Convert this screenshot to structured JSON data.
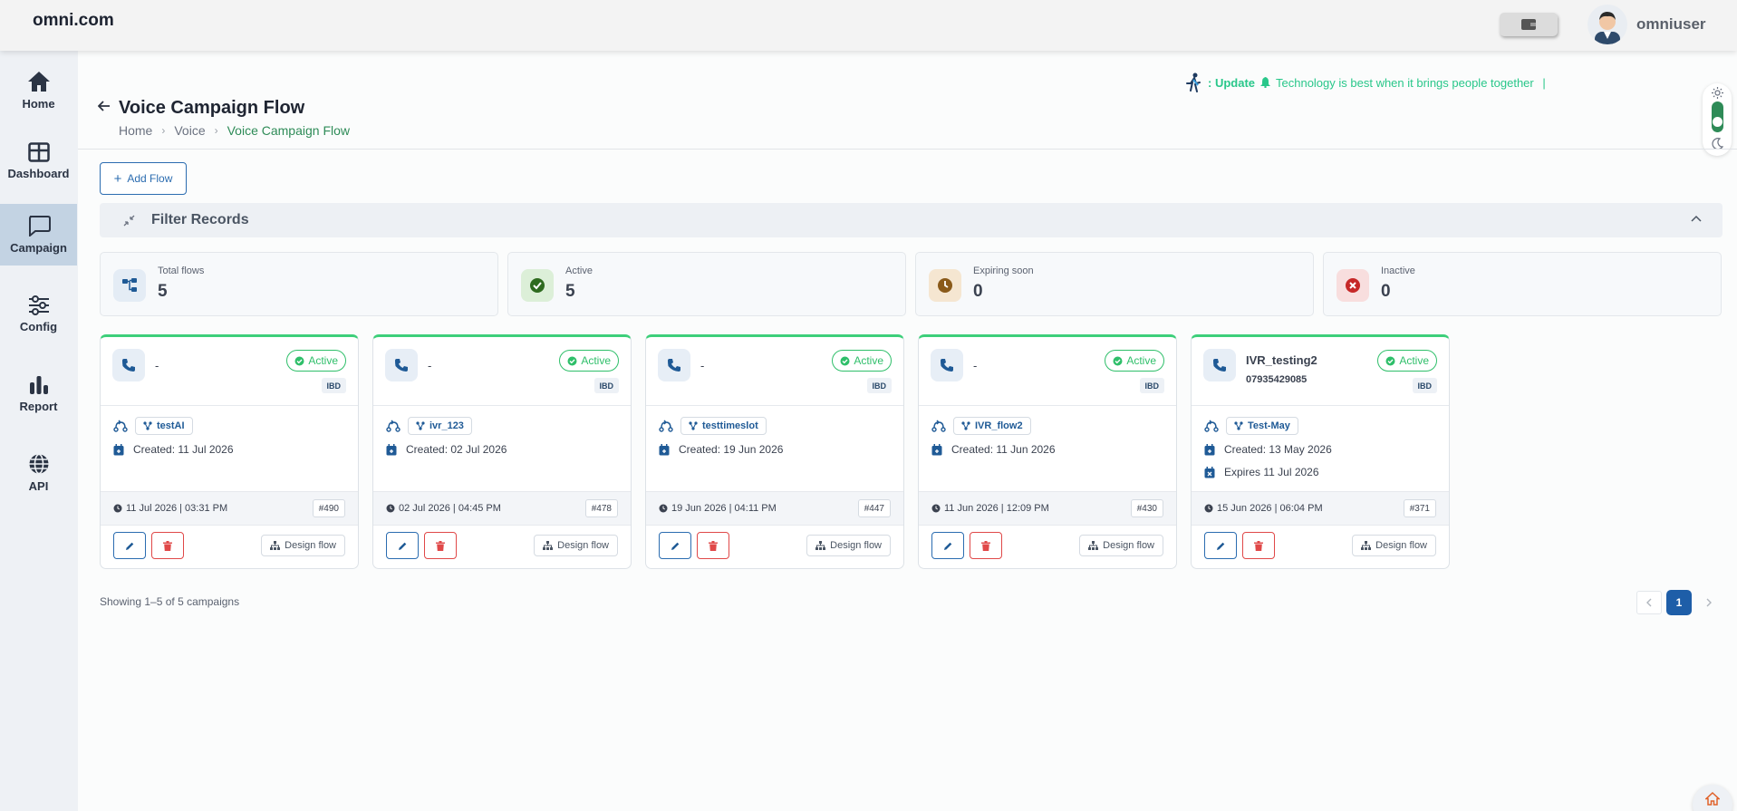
{
  "header": {
    "brand": "omni.com",
    "username": "omniuser"
  },
  "sidebar": {
    "items": [
      {
        "label": "Home",
        "icon": "home-icon"
      },
      {
        "label": "Dashboard",
        "icon": "dashboard-icon"
      },
      {
        "label": "Campaign",
        "icon": "campaign-icon",
        "active": true
      },
      {
        "label": "Config",
        "icon": "config-icon"
      },
      {
        "label": "Report",
        "icon": "report-icon"
      },
      {
        "label": "API",
        "icon": "globe-icon"
      }
    ]
  },
  "announcement": {
    "prefix": ": Update",
    "message": "Technology is best when it brings people together"
  },
  "page": {
    "title": "Voice Campaign Flow",
    "breadcrumb": [
      "Home",
      "Voice",
      "Voice Campaign Flow"
    ],
    "add_flow_label": "Add Flow",
    "filter_label": "Filter Records"
  },
  "stats": [
    {
      "label": "Total flows",
      "value": "5",
      "icon": "flow-icon",
      "color": "#1f5a96"
    },
    {
      "label": "Active",
      "value": "5",
      "icon": "check-circle-icon",
      "color": "#2e7d32"
    },
    {
      "label": "Expiring soon",
      "value": "0",
      "icon": "clock-icon",
      "color": "#8a5a1a"
    },
    {
      "label": "Inactive",
      "value": "0",
      "icon": "x-circle-icon",
      "color": "#c62828"
    }
  ],
  "cards": [
    {
      "name": "-",
      "number": "",
      "status": "Active",
      "type": "IBD",
      "flow": "testAI",
      "created": "Created: 11 Jul 2026",
      "expires": "",
      "timestamp": "11 Jul 2026 | 03:31 PM",
      "id": "#490",
      "design_label": "Design flow"
    },
    {
      "name": "-",
      "number": "",
      "status": "Active",
      "type": "IBD",
      "flow": "ivr_123",
      "created": "Created: 02 Jul 2026",
      "expires": "",
      "timestamp": "02 Jul 2026 | 04:45 PM",
      "id": "#478",
      "design_label": "Design flow"
    },
    {
      "name": "-",
      "number": "",
      "status": "Active",
      "type": "IBD",
      "flow": "testtimeslot",
      "created": "Created: 19 Jun 2026",
      "expires": "",
      "timestamp": "19 Jun 2026 | 04:11 PM",
      "id": "#447",
      "design_label": "Design flow"
    },
    {
      "name": "-",
      "number": "",
      "status": "Active",
      "type": "IBD",
      "flow": "IVR_flow2",
      "created": "Created: 11 Jun 2026",
      "expires": "",
      "timestamp": "11 Jun 2026 | 12:09 PM",
      "id": "#430",
      "design_label": "Design flow"
    },
    {
      "name": "IVR_testing2",
      "number": "07935429085",
      "status": "Active",
      "type": "IBD",
      "flow": "Test-May",
      "created": "Created: 13 May 2026",
      "expires": "Expires 11 Jul 2026",
      "timestamp": "15 Jun 2026 | 06:04 PM",
      "id": "#371",
      "design_label": "Design flow"
    }
  ],
  "pagination": {
    "summary": "Showing 1–5 of 5 campaigns",
    "current_page": "1"
  }
}
